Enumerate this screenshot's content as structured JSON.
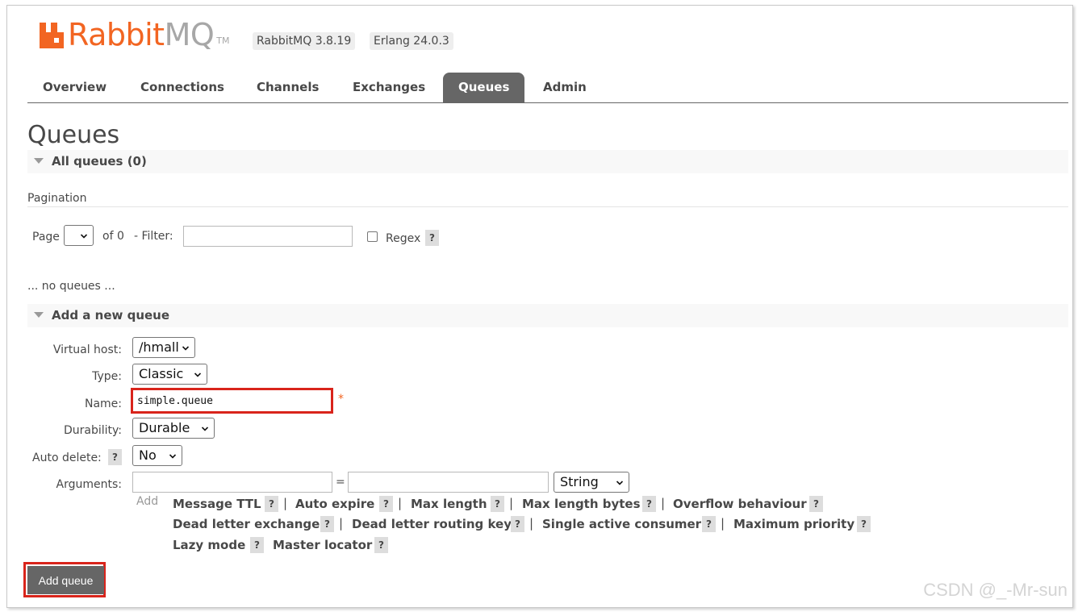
{
  "header": {
    "logo_rabbit": "Rabbit",
    "logo_mq": "MQ",
    "logo_tm": "TM",
    "rabbitmq_version": "RabbitMQ 3.8.19",
    "erlang_version": "Erlang 24.0.3"
  },
  "tabs": [
    {
      "label": "Overview"
    },
    {
      "label": "Connections"
    },
    {
      "label": "Channels"
    },
    {
      "label": "Exchanges"
    },
    {
      "label": "Queues"
    },
    {
      "label": "Admin"
    }
  ],
  "active_tab": "Queues",
  "page_title": "Queues",
  "all_queues": {
    "label": "All queues (0)",
    "pagination_label": "Pagination",
    "page_label": "Page",
    "page_value": "",
    "of_label": "of 0",
    "filter_label": "- Filter:",
    "filter_value": "",
    "regex_label": "Regex",
    "regex_checked": false,
    "help": "?",
    "empty_text": "... no queues ..."
  },
  "add_queue": {
    "section_label": "Add a new queue",
    "virtual_host_label": "Virtual host:",
    "virtual_host_value": "/hmall",
    "type_label": "Type:",
    "type_value": "Classic",
    "name_label": "Name:",
    "name_value": "simple.queue",
    "required_mark": "*",
    "durability_label": "Durability:",
    "durability_value": "Durable",
    "auto_delete_label": "Auto delete:",
    "auto_delete_value": "No",
    "arguments_label": "Arguments:",
    "arg_key_value": "",
    "arg_equals": "=",
    "arg_value": "",
    "arg_type_value": "String",
    "add_label": "Add",
    "separator": "|",
    "argument_links": [
      "Message TTL",
      "Auto expire",
      "Max length",
      "Max length bytes",
      "Overflow behaviour",
      "Dead letter exchange",
      "Dead letter routing key",
      "Single active consumer",
      "Maximum priority",
      "Lazy mode",
      "Master locator"
    ],
    "submit_label": "Add queue"
  },
  "watermark": "CSDN @_-Mr-sun",
  "colors": {
    "brand_orange": "#f26522",
    "active_tab_bg": "#666666",
    "highlight_red": "#d9241b",
    "help_bg": "#dddddd"
  }
}
